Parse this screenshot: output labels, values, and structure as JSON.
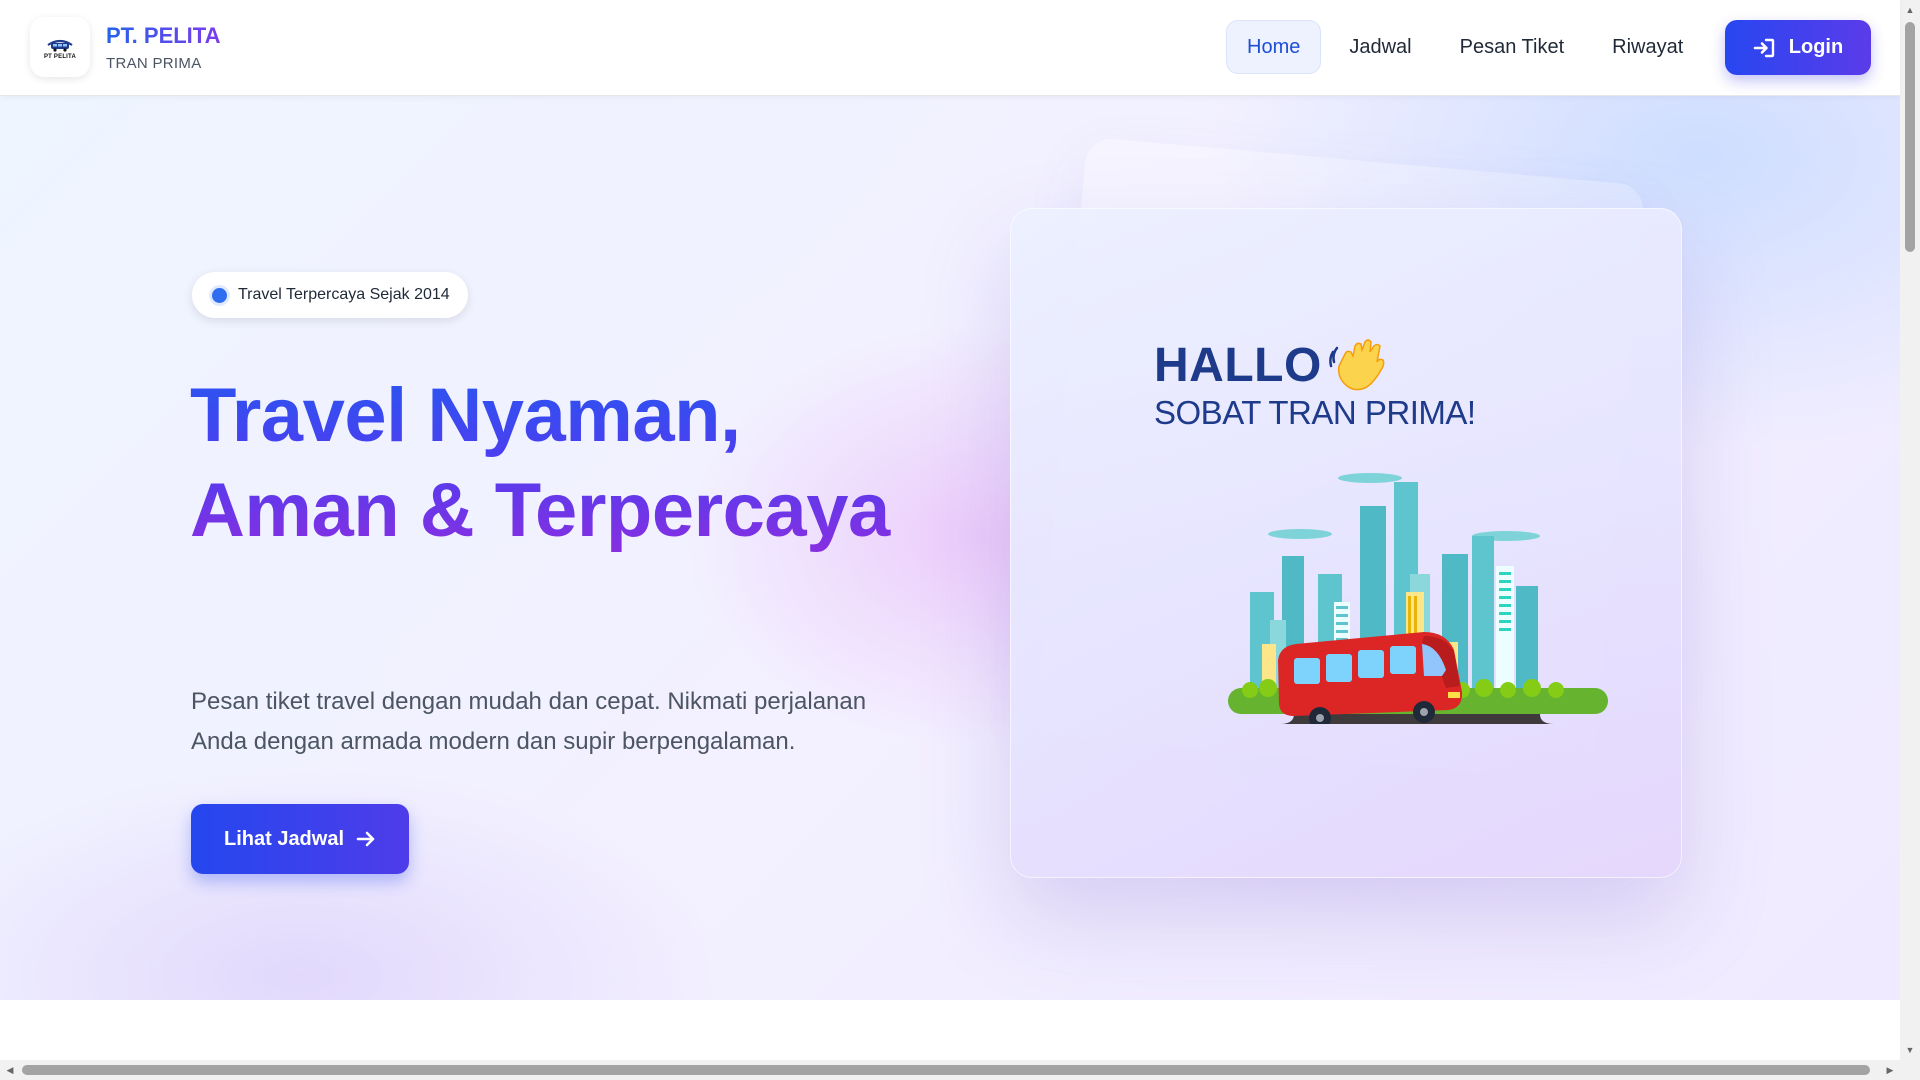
{
  "brand": {
    "name": "PT. PELITA",
    "sub": "TRAN PRIMA",
    "logo_text": "PT PELITA"
  },
  "nav": {
    "items": [
      {
        "label": "Home",
        "active": true
      },
      {
        "label": "Jadwal",
        "active": false
      },
      {
        "label": "Pesan Tiket",
        "active": false
      },
      {
        "label": "Riwayat",
        "active": false
      }
    ],
    "login_label": "Login",
    "login_icon": "login-icon"
  },
  "hero": {
    "badge": "Travel Terpercaya Sejak 2014",
    "title_line1": "Travel Nyaman,",
    "title_line2": "Aman & Terpercaya",
    "desc_line1": "Pesan tiket travel dengan mudah dan cepat. Nikmati perjalanan",
    "desc_line2": "Anda dengan armada modern dan supir berpengalaman.",
    "cta_label": "Lihat Jadwal",
    "cta_icon": "arrow-right-icon"
  },
  "illustration": {
    "greeting": "HALLO",
    "greeting_sub": "SOBAT TRAN PRIMA!",
    "wave_icon": "waving-hand-icon"
  },
  "colors": {
    "primary": "#2547ee",
    "accent_purple": "#7c3aed",
    "nav_active_bg": "#eef2ff",
    "text_dark": "#1f2937",
    "illustration_title": "#1e3a8a"
  }
}
